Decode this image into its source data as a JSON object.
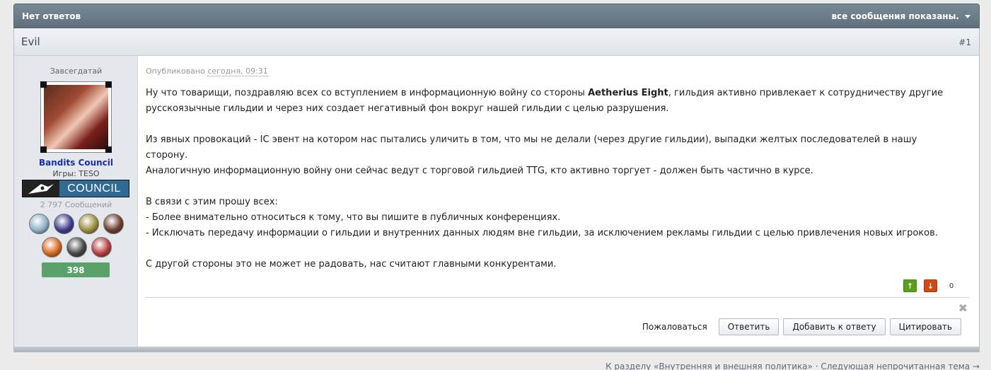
{
  "topbar": {
    "title": "Нет ответов",
    "filter_label": "все сообщения показаны."
  },
  "post": {
    "author": "Evil",
    "number": "#1",
    "published_label": "Опубликовано",
    "published_time": "сегодня, 09:31",
    "paragraphs": {
      "p1_a": "Ну что товарищи, поздравляю всех со вступлением в информационную войну со стороны ",
      "p1_bold": "Aetherius Eight",
      "p1_b": ", гильдия активно привлекает к сотрудничеству другие",
      "p1_c": "русскоязычные гильдии и через них создает негативный фон вокруг нашей гильдии с целью разрушения.",
      "p2_a": "Из явных провокаций - IC эвент на котором нас пытались уличить в том, что мы не делали (через другие гильдии), выпадки желтых последователей в нашу сторону.",
      "p2_b": "Аналогичную информационную войну они сейчас ведут с торговой гильдией TTG, кто активно торгует - должен быть частично в курсе.",
      "p3_a": "В связи с этим прошу всех:",
      "p3_b": "- Более внимательно относиться к тому, что вы пишите в публичных конференциях.",
      "p3_c": "- Исключать передачу информации о гильдии и внутренних данных людям вне гильдии, за исключением рекламы гильдии с целью привлечения новых игроков.",
      "p4": "С другой стороны это не может не радовать, нас считают главными конкурентами."
    },
    "votes": {
      "up": "↑",
      "down": "↓",
      "count": "0"
    },
    "actions": {
      "report": "Пожаловаться",
      "reply": "Ответить",
      "add_to_reply": "Добавить к ответу",
      "quote": "Цитировать"
    }
  },
  "user": {
    "rank": "Завсегдатай",
    "group": "Bandits Council",
    "games": "Игры: TESO",
    "banner_text": "COUNCIL",
    "message_count": "2 797 Сообщений",
    "reputation": "398",
    "trophies": [
      {
        "name": "scroll-trophy-icon",
        "color": "#8fb0c8"
      },
      {
        "name": "wizard-trophy-icon",
        "color": "#3b3a8a"
      },
      {
        "name": "orc-trophy-icon",
        "color": "#9a8b3a"
      },
      {
        "name": "warrior-trophy-icon",
        "color": "#6b3b2b"
      },
      {
        "name": "fire-trophy-icon",
        "color": "#d3661b"
      },
      {
        "name": "dragon-trophy-icon",
        "color": "#444444"
      },
      {
        "name": "guild-badge-trophy-icon",
        "color": "#b83a3a"
      }
    ]
  },
  "bottom_nav": {
    "back_link": "К разделу «Внутренняя и внешняя политика»",
    "separator": "·",
    "next_link": "Следующая непрочитанная тема →"
  },
  "colors": {
    "topbar": "#6a7b88",
    "group_name": "#1a2fb0",
    "reputation": "#5aa26a",
    "vote_up": "#5c9e1a",
    "vote_down": "#d14a12"
  }
}
